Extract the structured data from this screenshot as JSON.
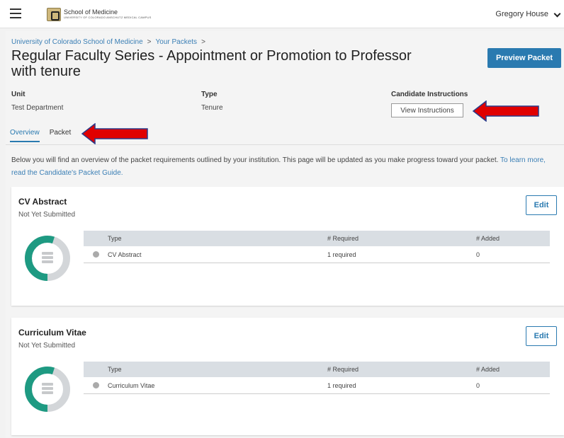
{
  "header": {
    "logo_line1": "School of Medicine",
    "logo_line2": "UNIVERSITY OF COLORADO ANSCHUTZ MEDICAL CAMPUS",
    "user_name": "Gregory House"
  },
  "breadcrumb": {
    "items": [
      "University of Colorado School of Medicine",
      "Your Packets"
    ],
    "separator": ">"
  },
  "page": {
    "title": "Regular Faculty Series - Appointment or Promotion to Professor with tenure",
    "preview_button": "Preview Packet"
  },
  "meta": {
    "unit_label": "Unit",
    "unit_value": "Test Department",
    "type_label": "Type",
    "type_value": "Tenure",
    "instructions_label": "Candidate Instructions",
    "instructions_button": "View Instructions"
  },
  "tabs": [
    {
      "label": "Overview",
      "active": true
    },
    {
      "label": "Packet",
      "active": false
    }
  ],
  "intro": {
    "text": "Below you will find an overview of the packet requirements outlined by your institution. This page will be updated as you make progress toward your packet.",
    "link_text": "To learn more, read the Candidate's Packet Guide."
  },
  "table_headers": {
    "type": "Type",
    "required": "# Required",
    "added": "# Added"
  },
  "cards": [
    {
      "title": "CV Abstract",
      "status": "Not Yet Submitted",
      "edit_label": "Edit",
      "row": {
        "type": "CV Abstract",
        "required": "1 required",
        "added": "0"
      },
      "progress": 0.55
    },
    {
      "title": "Curriculum Vitae",
      "status": "Not Yet Submitted",
      "edit_label": "Edit",
      "row": {
        "type": "Curriculum Vitae",
        "required": "1 required",
        "added": "0"
      },
      "progress": 0.55
    }
  ],
  "colors": {
    "accent": "#2a7ab0",
    "donut_fill": "#1e9a82",
    "donut_track": "#d3d6d9",
    "arrow": "#e00000"
  },
  "icons": [
    "menu-icon",
    "university-logo-icon",
    "chevron-down-icon",
    "document-stack-icon",
    "arrow-left-icon"
  ]
}
